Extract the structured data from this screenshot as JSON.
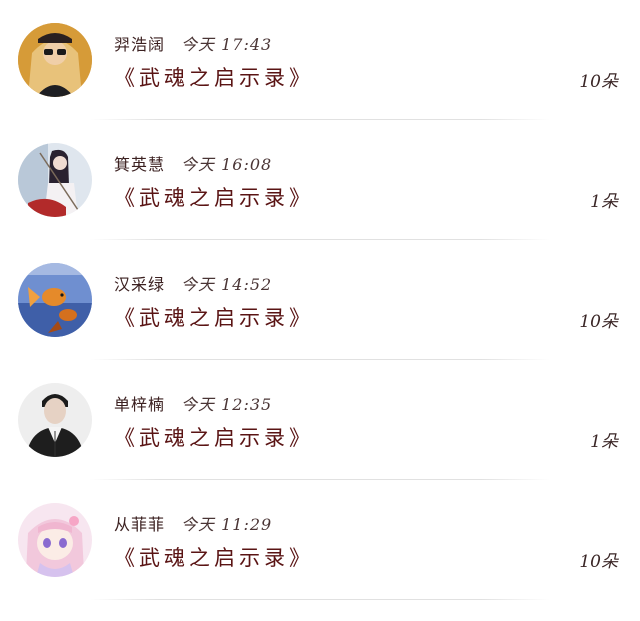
{
  "gift_list": {
    "items": [
      {
        "name": "羿浩阔",
        "time": "今天 17:43",
        "title": "《武魂之启示录》",
        "count": "10朵",
        "avatar": "avatar-photo-woman-sunglasses"
      },
      {
        "name": "箕英慧",
        "time": "今天 16:08",
        "title": "《武魂之启示录》",
        "count": "1朵",
        "avatar": "avatar-photo-hanfu-girl"
      },
      {
        "name": "汉采绿",
        "time": "今天 14:52",
        "title": "《武魂之启示录》",
        "count": "10朵",
        "avatar": "avatar-photo-goldfish"
      },
      {
        "name": "单梓楠",
        "time": "今天 12:35",
        "title": "《武魂之启示录》",
        "count": "1朵",
        "avatar": "avatar-photo-man-coat"
      },
      {
        "name": "从菲菲",
        "time": "今天 11:29",
        "title": "《武魂之启示录》",
        "count": "10朵",
        "avatar": "avatar-anime-girl-pink"
      }
    ]
  }
}
